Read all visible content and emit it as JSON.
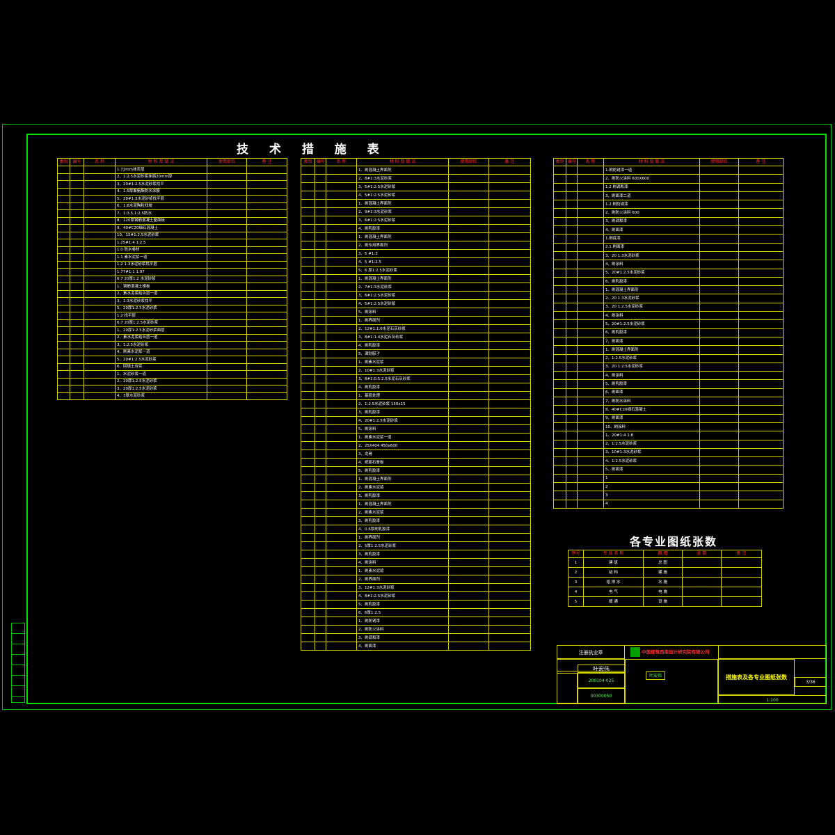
{
  "title": "技 术 措 施 表",
  "title2": "各专业图纸张数",
  "colors": {
    "frame": "#00e000",
    "table_line": "#d8d800",
    "header_text": "#ff3030",
    "text": "#ffffff",
    "accent": "#5cff5c"
  },
  "t1": {
    "headers": [
      "类别",
      "编号",
      "名 称",
      "材 料 及 做 法",
      "使用部位",
      "备 注"
    ],
    "rows": [
      "1.72mm抹灰层",
      "2、1:2.5水泥砂浆抹面20mm厚",
      "3、20#1:2.5水泥砂浆找平",
      "4、1.5厚聚氨酯防水涂膜",
      "5、20#1:3水泥砂浆找平层",
      "6、1:8水泥陶粒找坡",
      "7、1:3.5,1:2.5防水",
      "8、120厚钢筋混凝土屋面板",
      "9、40#C20细石混凝土",
      "10、15#1:2.5水泥砂浆",
      "1.25#1:4 1:2.5",
      "1.0 防水卷材",
      "1.1 素水泥浆一道",
      "1.2 1:3水泥砂浆找平层",
      "1.77#1:1 1.97",
      "6.7 20厚1:2 水泥砂浆",
      "1、钢筋混凝土楼板",
      "2、素水泥浆结合层一道",
      "3、1:3水泥砂浆找平",
      "5、20厚1:2.5水泥砂浆",
      "1.2 找平层",
      "6.7 20厚1:2.5水泥砂浆",
      "1、20厚1:2.5水泥砂浆面层",
      "2、素水泥浆结合层一道",
      "3、1:2.5水泥砂浆",
      "4、刷素水泥浆一道",
      "5、20#1:2.5水泥砂浆",
      "6、回填土夯实",
      "1、水泥砂浆一道",
      "2、20厚1:2.5水泥砂浆",
      "3、20厚1:2.5水泥砂浆",
      "4、3厚水泥砂浆"
    ]
  },
  "t2": {
    "headers": [
      "类别",
      "编号",
      "名 称",
      "材 料 及 做 法",
      "使用部位",
      "备 注"
    ],
    "rows": [
      "1、刷混凝土界面剂",
      "2、8#1:3水泥砂浆",
      "3、5#1:2.5水泥砂浆",
      "4、5#1:2.5水泥砂浆",
      "1、刷混凝土界面剂",
      "2、9#1:3水泥砂浆",
      "3、6#1:2.5水泥砂浆",
      "4、刷乳胶漆",
      "1、刷混凝土界面剂",
      "2、刷专用界面剂",
      "3、5 #1:3",
      "4、5 #1:2.5",
      "5、6 厚1:2.5水泥砂浆",
      "1、刷混凝土界面剂",
      "2、7#1:3水泥砂浆",
      "3、6#1:2.5水泥砂浆",
      "4、5#1:2.5水泥砂浆",
      "5、刷涂料",
      "1、刷界面剂",
      "2、12#1:1:6水泥石灰砂浆",
      "3、8#1:1:4水泥石灰砂浆",
      "4、刷乳胶漆",
      "5、满刮腻子",
      "1、刷素水泥浆",
      "2、10#1:3水泥砂浆",
      "3、8#1:0.5:2.5水泥石灰砂浆",
      "4、刷乳胶漆",
      "1、基层处理",
      "2、1:2.5水泥砂浆 150x15",
      "3、刷乳胶漆",
      "4、20#1:2.5水泥砂浆",
      "5、刷涂料",
      "1、刷素水泥浆一道",
      "2、25X404 450x600",
      "3、龙骨",
      "4、纸面石膏板",
      "5、刷乳胶漆",
      "1、刷混凝土界面剂",
      "2、刷素水泥浆",
      "3、刷乳胶漆",
      "1、刷混凝土界面剂",
      "2、刷素水泥浆",
      "3、刷乳胶漆",
      "4、0.6厚刷乳胶漆",
      "1、刷界面剂",
      "2、5厚1:2.5水泥砂浆",
      "3、刷乳胶漆",
      "4、刷涂料",
      "1、刷素水泥浆",
      "2、刷界面剂",
      "3、12#1:3水泥砂浆",
      "4、8#1:2.5水泥砂浆",
      "5、刷乳胶漆",
      "6、6厚1:2.5",
      "1、刷防锈漆",
      "2、刷防火涂料",
      "3、刷调和漆",
      "4、刷面漆"
    ]
  },
  "t3": {
    "headers": [
      "类别",
      "编号",
      "名 称",
      "材 料 及 做 法",
      "使用部位",
      "备 注"
    ],
    "rows": [
      "1.刷防锈漆一道",
      "2、刷防火涂料 600X600",
      "1.2 刷调和漆",
      "3、刷面漆二道",
      "1.2 刷防锈漆",
      "2、刷防火涂料 600",
      "3、刷调和漆",
      "4、刷面漆",
      "1.刷底漆",
      "2.1 刷面漆",
      "3、20 1:3水泥砂浆",
      "4、刷涂料",
      "5、20#1:2.5水泥砂浆",
      "6、刷乳胶漆",
      "1、刷混凝土界面剂",
      "2、20 1:3水泥砂浆",
      "3、20 1:2.5水泥砂浆",
      "4、刷涂料",
      "5、20#1:2.5水泥砂浆",
      "6、刷乳胶漆",
      "7、刷面漆",
      "1、刷混凝土界面剂",
      "2、1:2.5水泥砂浆",
      "3、20 1:2.5水泥砂浆",
      "4、刷涂料",
      "5、刷乳胶漆",
      "6、刷面漆",
      "7、刷防水涂料",
      "8、40#C20细石混凝土",
      "9、刷面漆",
      "10、刷涂料",
      "1、20#1:4 1:8",
      "2、1:2.5水泥砂浆",
      "3、10#1:3水泥砂浆",
      "4、1:2.5水泥砂浆",
      "5、刷面漆",
      "1",
      "2",
      "3",
      "4"
    ]
  },
  "t4": {
    "headers": [
      "序号",
      "专 业 名 称",
      "图 幅",
      "张 数",
      "备 注"
    ],
    "rows": [
      [
        "1",
        "建 筑",
        "总 图",
        "",
        ""
      ],
      [
        "2",
        "结 构",
        "建 施",
        "",
        ""
      ],
      [
        "3",
        "给 排 水",
        "水 施",
        "",
        ""
      ],
      [
        "4",
        "电 气",
        "电 施",
        "",
        ""
      ],
      [
        "5",
        "暖 通",
        "设 施",
        "",
        ""
      ]
    ]
  },
  "titleblock": {
    "company": "中国建筑西南设计研究院有限公司",
    "drawing_name": "措施表及各专业图纸张数",
    "drawing_no": "3/36",
    "scale": "1:100",
    "designer": "叶宏伟",
    "checker": "叶宏伟",
    "reg_no": "200104-025",
    "cert_no": "00300050",
    "stamp": "注册执业章"
  }
}
